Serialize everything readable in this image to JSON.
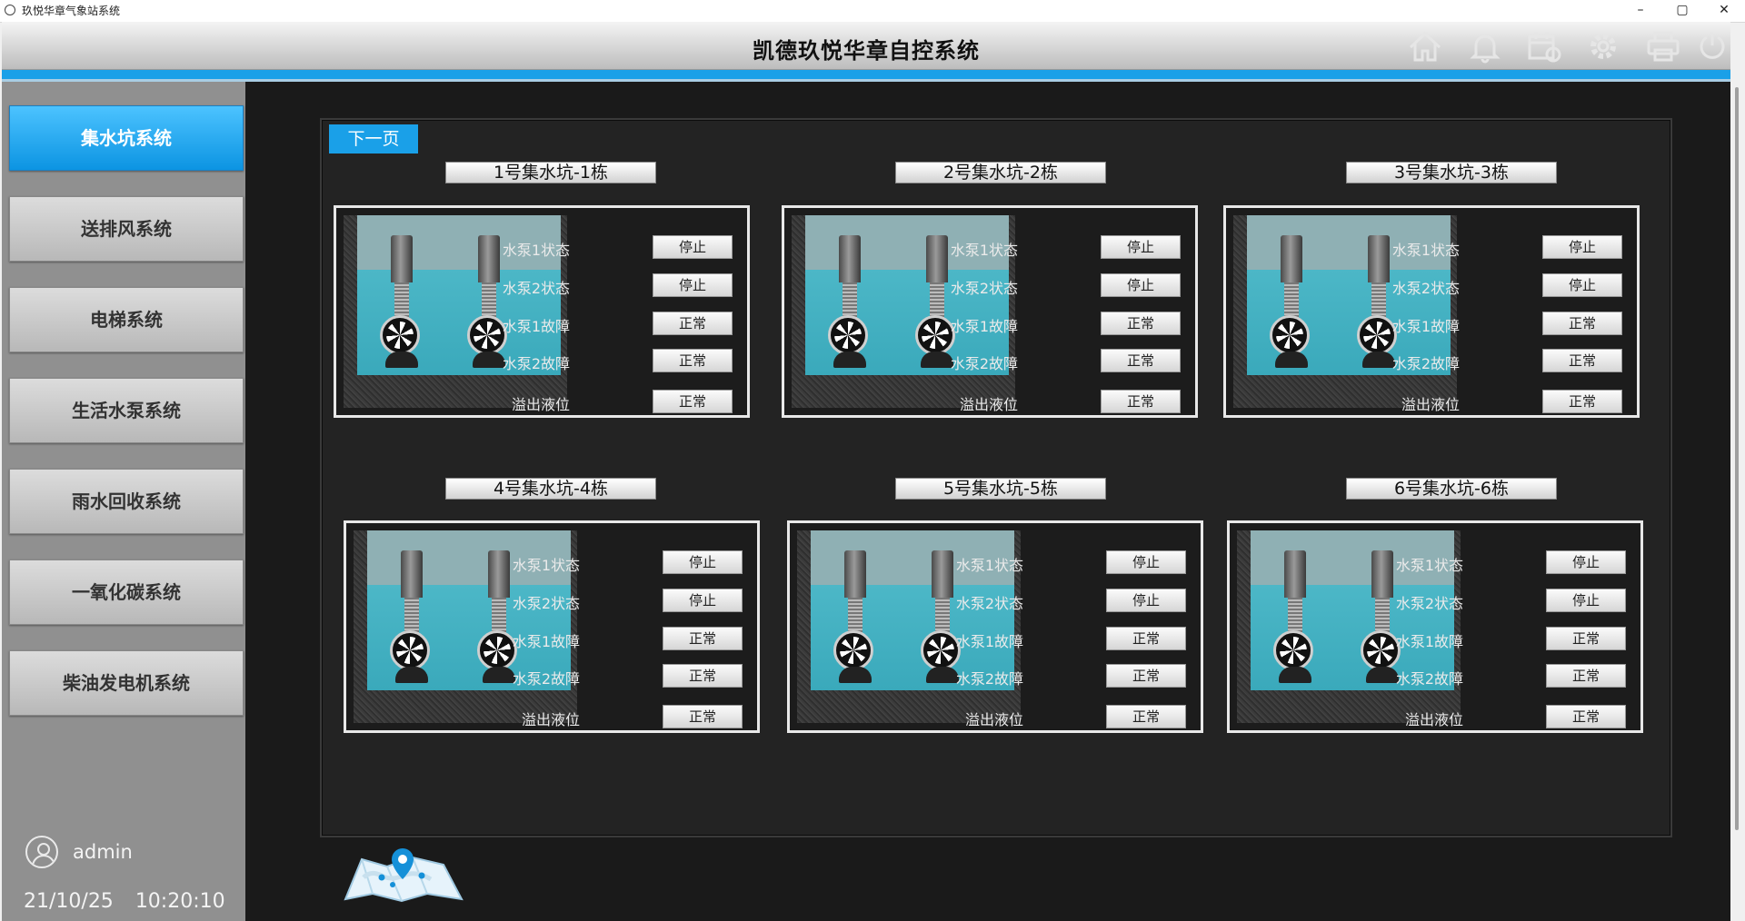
{
  "window": {
    "title": "玖悦华章气象站系统",
    "minimize": "–",
    "maximize": "▢",
    "close": "✕"
  },
  "header": {
    "title": "凯德玖悦华章自控系统",
    "icons": [
      "home-icon",
      "bell-icon",
      "calendar-icon",
      "gear-icon",
      "printer-icon",
      "power-icon"
    ]
  },
  "sidebar": {
    "items": [
      {
        "label": "集水坑系统",
        "active": true
      },
      {
        "label": "送排风系统",
        "active": false
      },
      {
        "label": "电梯系统",
        "active": false
      },
      {
        "label": "生活水泵系统",
        "active": false
      },
      {
        "label": "雨水回收系统",
        "active": false
      },
      {
        "label": "一氧化碳系统",
        "active": false
      },
      {
        "label": "柴油发电机系统",
        "active": false
      }
    ],
    "user": "admin",
    "date": "21/10/25",
    "time": "10:20:10"
  },
  "main": {
    "next_page": "下一页",
    "pits": [
      {
        "title": "1号集水坑-1栋",
        "rows": [
          {
            "label": "水泵1状态",
            "value": "停止"
          },
          {
            "label": "水泵2状态",
            "value": "停止"
          },
          {
            "label": "水泵1故障",
            "value": "正常"
          },
          {
            "label": "水泵2故障",
            "value": "正常"
          },
          {
            "label": "溢出液位",
            "value": "正常"
          }
        ]
      },
      {
        "title": "2号集水坑-2栋",
        "rows": [
          {
            "label": "水泵1状态",
            "value": "停止"
          },
          {
            "label": "水泵2状态",
            "value": "停止"
          },
          {
            "label": "水泵1故障",
            "value": "正常"
          },
          {
            "label": "水泵2故障",
            "value": "正常"
          },
          {
            "label": "溢出液位",
            "value": "正常"
          }
        ]
      },
      {
        "title": "3号集水坑-3栋",
        "rows": [
          {
            "label": "水泵1状态",
            "value": "停止"
          },
          {
            "label": "水泵2状态",
            "value": "停止"
          },
          {
            "label": "水泵1故障",
            "value": "正常"
          },
          {
            "label": "水泵2故障",
            "value": "正常"
          },
          {
            "label": "溢出液位",
            "value": "正常"
          }
        ]
      },
      {
        "title": "4号集水坑-4栋",
        "rows": [
          {
            "label": "水泵1状态",
            "value": "停止"
          },
          {
            "label": "水泵2状态",
            "value": "停止"
          },
          {
            "label": "水泵1故障",
            "value": "正常"
          },
          {
            "label": "水泵2故障",
            "value": "正常"
          },
          {
            "label": "溢出液位",
            "value": "正常"
          }
        ]
      },
      {
        "title": "5号集水坑-5栋",
        "rows": [
          {
            "label": "水泵1状态",
            "value": "停止"
          },
          {
            "label": "水泵2状态",
            "value": "停止"
          },
          {
            "label": "水泵1故障",
            "value": "正常"
          },
          {
            "label": "水泵2故障",
            "value": "正常"
          },
          {
            "label": "溢出液位",
            "value": "正常"
          }
        ]
      },
      {
        "title": "6号集水坑-6栋",
        "rows": [
          {
            "label": "水泵1状态",
            "value": "停止"
          },
          {
            "label": "水泵2状态",
            "value": "停止"
          },
          {
            "label": "水泵1故障",
            "value": "正常"
          },
          {
            "label": "水泵2故障",
            "value": "正常"
          },
          {
            "label": "溢出液位",
            "value": "正常"
          }
        ]
      }
    ]
  },
  "colors": {
    "accent": "#1aa0e8",
    "sidebar_bg": "#909090",
    "main_bg": "#1a1a1a"
  }
}
